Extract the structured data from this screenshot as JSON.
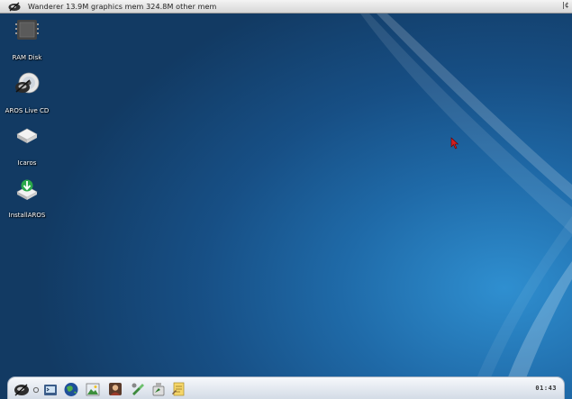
{
  "menubar": {
    "title": "Wanderer 13.9M graphics mem 324.8M other mem",
    "right_text": "|¢"
  },
  "desktop": {
    "icons": [
      {
        "label": "RAM Disk",
        "icon": "ram-disk-icon"
      },
      {
        "label": "AROS Live CD",
        "icon": "cd-icon"
      },
      {
        "label": "Icaros",
        "icon": "drive-icon"
      },
      {
        "label": "InstallAROS",
        "icon": "install-icon"
      }
    ]
  },
  "dock": {
    "items": [
      "aros-menu-icon",
      "separator-dot-icon",
      "shell-icon",
      "browser-globe-icon",
      "image-viewer-icon",
      "user-icon",
      "tools-icon",
      "paint-icon",
      "notes-icon"
    ],
    "clock": "01:43"
  },
  "colors": {
    "desktop_dark": "#123a63",
    "desktop_light": "#2f8fd0",
    "menubar": "#e0e0e0",
    "dock": "#dfe5ee",
    "cursor": "#d42020"
  }
}
